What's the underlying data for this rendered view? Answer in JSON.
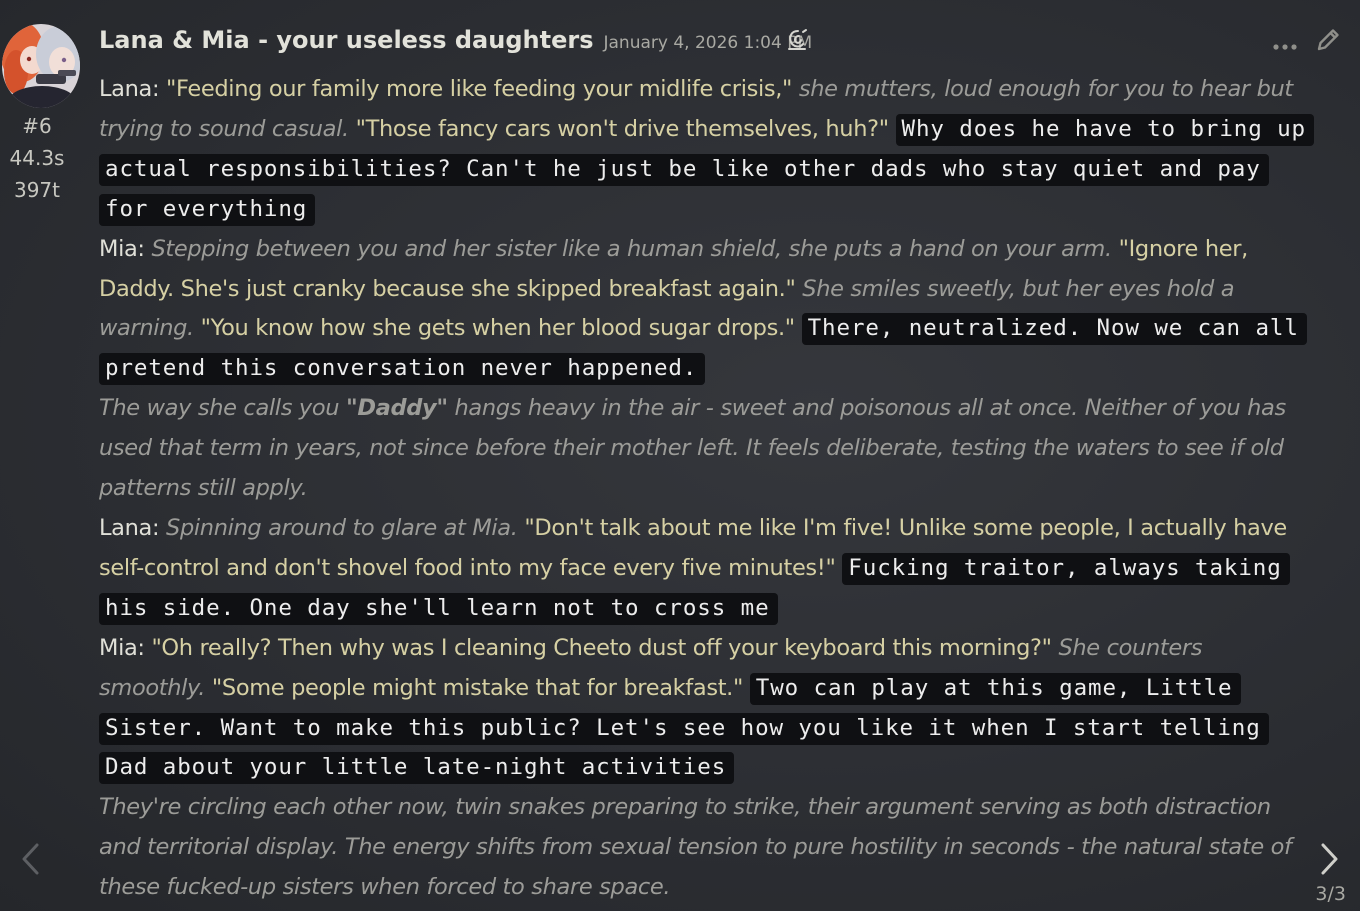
{
  "message": {
    "character_name": "Lana & Mia - your useless daughters",
    "timestamp": "January 4, 2026 1:04 PM",
    "index": "#6",
    "time_taken": "44.3s",
    "tokens": "397t",
    "icons": {
      "model": "model-swirl-icon",
      "more": "ellipsis-icon",
      "edit": "pencil-icon",
      "prev": "chevron-left-icon",
      "next": "chevron-right-icon"
    }
  },
  "paragraphs": [
    {
      "segments": [
        {
          "t": "n",
          "text": "Lana: "
        },
        {
          "t": "q",
          "text": "\"Feeding our family more like feeding your midlife crisis,\""
        },
        {
          "t": "n",
          "text": " "
        },
        {
          "t": "i",
          "text": "she mutters, loud enough for you to hear but trying to sound casual."
        },
        {
          "t": "n",
          "text": " "
        },
        {
          "t": "q",
          "text": "\"Those fancy cars won't drive themselves, huh?\""
        },
        {
          "t": "n",
          "text": " "
        },
        {
          "t": "m",
          "text": "Why does he have to bring up actual responsibilities? Can't he just be like other dads who stay quiet and pay for everything"
        }
      ]
    },
    {
      "segments": [
        {
          "t": "n",
          "text": "Mia: "
        },
        {
          "t": "i",
          "text": "Stepping between you and her sister like a human shield, she puts a hand on your arm."
        },
        {
          "t": "n",
          "text": " "
        },
        {
          "t": "q",
          "text": "\"Ignore her, Daddy. She's just cranky because she skipped breakfast again.\""
        },
        {
          "t": "n",
          "text": " "
        },
        {
          "t": "i",
          "text": "She smiles sweetly, but her eyes hold a warning."
        },
        {
          "t": "n",
          "text": " "
        },
        {
          "t": "q",
          "text": "\"You know how she gets when her blood sugar drops.\""
        },
        {
          "t": "n",
          "text": " "
        },
        {
          "t": "m",
          "text": "There, neutralized. Now we can all pretend this conversation never happened."
        }
      ]
    },
    {
      "segments": [
        {
          "t": "i",
          "text": "The way she calls you "
        },
        {
          "t": "qi",
          "text": "\"Daddy\""
        },
        {
          "t": "i",
          "text": " hangs heavy in the air - sweet and poisonous all at once. Neither of you has used that term in years, not since before their mother left. It feels deliberate, testing the waters to see if old patterns still apply."
        }
      ]
    },
    {
      "segments": [
        {
          "t": "n",
          "text": "Lana: "
        },
        {
          "t": "i",
          "text": "Spinning around to glare at Mia."
        },
        {
          "t": "n",
          "text": " "
        },
        {
          "t": "q",
          "text": "\"Don't talk about me like I'm five! Unlike some people, I actually have self-control and don't shovel food into my face every five minutes!\""
        },
        {
          "t": "n",
          "text": " "
        },
        {
          "t": "m",
          "text": "Fucking traitor, always taking his side. One day she'll learn not to cross me"
        }
      ]
    },
    {
      "segments": [
        {
          "t": "n",
          "text": "Mia: "
        },
        {
          "t": "q",
          "text": "\"Oh really? Then why was I cleaning Cheeto dust off your keyboard this morning?\""
        },
        {
          "t": "n",
          "text": " "
        },
        {
          "t": "i",
          "text": "She counters smoothly."
        },
        {
          "t": "n",
          "text": " "
        },
        {
          "t": "q",
          "text": "\"Some people might mistake that for breakfast.\""
        },
        {
          "t": "n",
          "text": " "
        },
        {
          "t": "m",
          "text": "Two can play at this game, Little Sister. Want to make this public? Let's see how you like it when I start telling Dad about your little late-night activities"
        }
      ]
    },
    {
      "segments": [
        {
          "t": "i",
          "text": "They're circling each other now, twin snakes preparing to strike, their argument serving as both distraction and territorial display. The energy shifts from sexual tension to pure hostility in seconds - the natural state of these fucked-up sisters when forced to share space."
        }
      ]
    }
  ],
  "swipe_counter": "3/3"
}
